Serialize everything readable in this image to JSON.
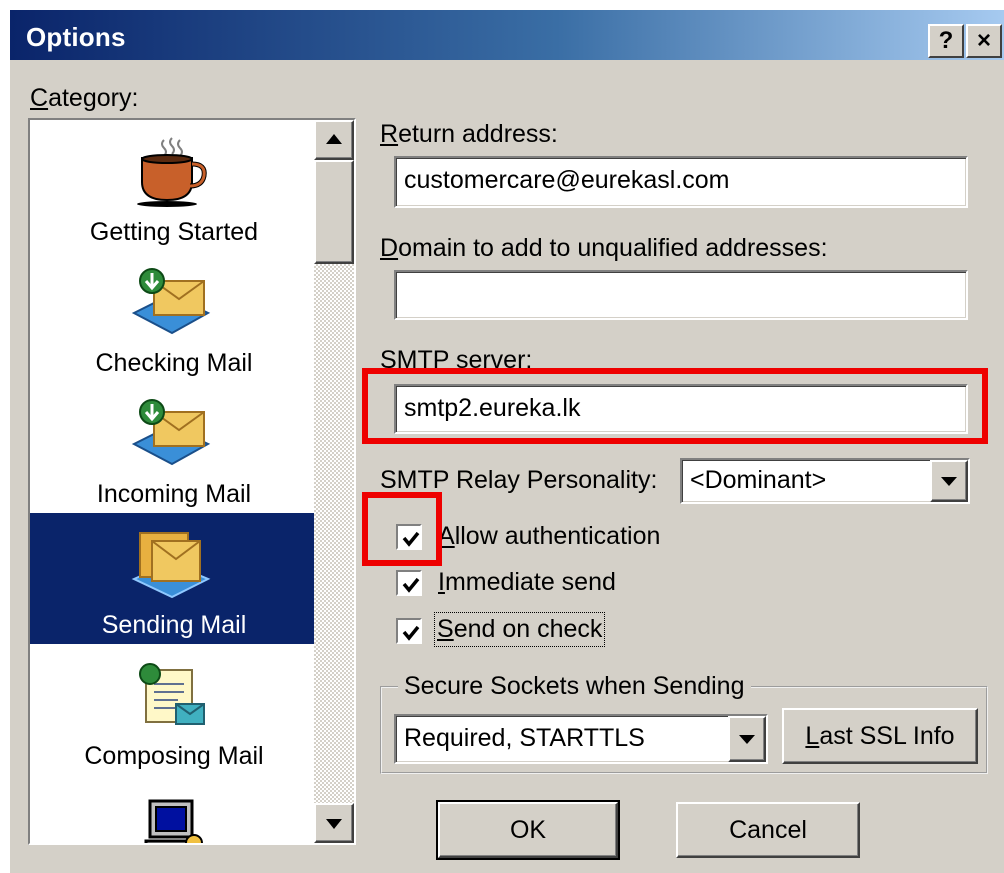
{
  "window": {
    "title": "Options",
    "help_button": "?",
    "close_button": "×"
  },
  "category": {
    "label_accel": "C",
    "label_rest": "ategory:",
    "items": [
      {
        "label": "Getting Started",
        "icon": "coffee-cup-icon",
        "selected": false
      },
      {
        "label": "Checking Mail",
        "icon": "check-mail-icon",
        "selected": false
      },
      {
        "label": "Incoming Mail",
        "icon": "incoming-mail-icon",
        "selected": false
      },
      {
        "label": "Sending Mail",
        "icon": "sending-mail-icon",
        "selected": true
      },
      {
        "label": "Composing Mail",
        "icon": "composing-mail-icon",
        "selected": false
      },
      {
        "label": "",
        "icon": "computer-icon",
        "selected": false
      }
    ]
  },
  "form": {
    "return_address": {
      "label_accel": "R",
      "label_rest": "eturn address:",
      "value": "customercare@eurekasl.com"
    },
    "domain": {
      "label_accel": "D",
      "label_rest": "omain to add to unqualified addresses:",
      "value": ""
    },
    "smtp_server": {
      "label": "SMTP server:",
      "value": "smtp2.eureka.lk"
    },
    "relay": {
      "label": "SMTP Relay Personality:",
      "value": "<Dominant>"
    },
    "checkboxes": [
      {
        "accel": "A",
        "rest": "llow authentication",
        "checked": true
      },
      {
        "accel": "I",
        "rest": "mmediate send",
        "checked": true
      },
      {
        "accel": "S",
        "rest": "end on check",
        "checked": true
      }
    ],
    "ssl": {
      "group_label": "Secure Sockets when Sending",
      "value": "Required, STARTTLS",
      "button_accel": "L",
      "button_rest": "ast SSL Info"
    }
  },
  "buttons": {
    "ok": "OK",
    "cancel": "Cancel"
  },
  "highlight_color": "#ee0000"
}
